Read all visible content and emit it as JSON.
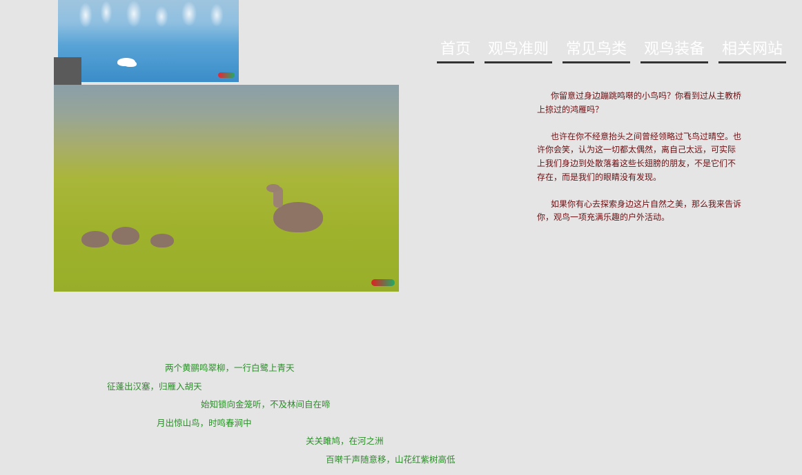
{
  "nav": {
    "items": [
      {
        "label": "首页"
      },
      {
        "label": "观鸟准则"
      },
      {
        "label": "常见鸟类"
      },
      {
        "label": "观鸟装备"
      },
      {
        "label": "相关网站"
      }
    ]
  },
  "intro": {
    "paragraphs": [
      "你留意过身边蹦跳鸣啭的小鸟吗？你看到过从主教桥上掠过的鸿雁吗？",
      "也许在你不经意抬头之间曾经领略过飞鸟过晴空。也许你会笑，认为这一切都太偶然，离自己太远，可实际上我们身边到处散落着这些长翅膀的朋友，不是它们不存在，而是我们的眼睛没有发现。",
      "如果你有心去探索身边这片自然之美，那么我来告诉你，观鸟一项充满乐趣的户外活动。"
    ]
  },
  "poem": {
    "lines": [
      "两个黄鹂鸣翠柳，一行白鹭上青天",
      "征蓬出汉塞，归雁入胡天",
      "始知锁向金笼听，不及林间自在啼",
      "月出惊山鸟，时鸣春涧中",
      "关关雎鸠，在河之洲",
      "百啭千声随意移，山花红紫树高低"
    ]
  },
  "colors": {
    "background": "#e6e5e5",
    "nav_text": "#ffffff",
    "nav_underline": "#333333",
    "intro_text": "#6b0f12",
    "poem_text": "#2c8c2a"
  }
}
